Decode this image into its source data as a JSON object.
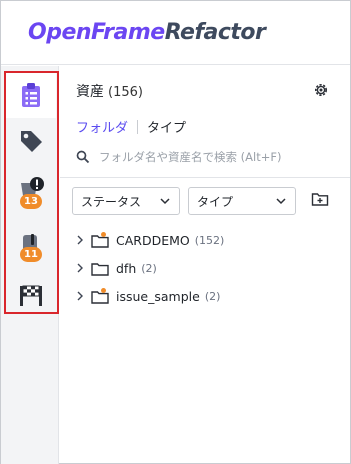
{
  "app": {
    "brand_part1": "OpenFrame",
    "brand_part2": "Refactor",
    "brand_colors": {
      "primary": "#6b46f2",
      "secondary": "#3e4a5e"
    }
  },
  "rail": {
    "items": [
      {
        "icon": "clipboard-list-icon",
        "active": true
      },
      {
        "icon": "tag-icon",
        "active": false
      },
      {
        "icon": "dataset-warning-icon",
        "badge": "13"
      },
      {
        "icon": "database-alert-icon",
        "badge": "11"
      },
      {
        "icon": "finish-flag-icon",
        "active": false
      }
    ],
    "highlight_color": "#d9262c",
    "badge_color": "#f08c2a"
  },
  "panel": {
    "title": "資産",
    "count": "(156)",
    "tabs": {
      "folder": "フォルダ",
      "type": "タイプ"
    },
    "search": {
      "placeholder": "フォルダ名や資産名で検索 (Alt+F)"
    },
    "filters": {
      "status": "ステータス",
      "type": "タイプ"
    },
    "tree": [
      {
        "name": "CARDDEMO",
        "count": "(152)",
        "has_dot": true
      },
      {
        "name": "dfh",
        "count": "(2)",
        "has_dot": false
      },
      {
        "name": "issue_sample",
        "count": "(2)",
        "has_dot": true
      }
    ],
    "accent": "#5b4cf0"
  }
}
